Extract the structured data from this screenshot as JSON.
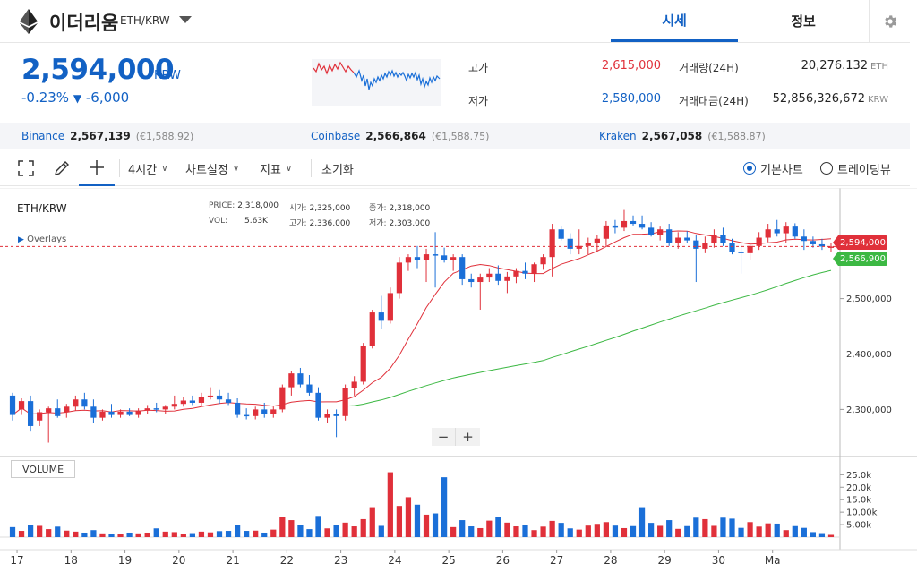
{
  "header": {
    "coin_name": "이더리움",
    "pair": "ETH/KRW",
    "tabs": [
      {
        "label": "시세",
        "active": true
      },
      {
        "label": "정보",
        "active": false
      }
    ]
  },
  "summary": {
    "price": "2,594,000",
    "unit": "KRW",
    "change_rate": "-0.23%",
    "change_arrow": "▼",
    "change_amount": "-6,000",
    "high_label": "고가",
    "high_value": "2,615,000",
    "low_label": "저가",
    "low_value": "2,580,000",
    "volume_label": "거래량(24H)",
    "volume_value": "20,276.132",
    "volume_unit": "ETH",
    "amount_label": "거래대금(24H)",
    "amount_value": "52,856,326,672",
    "amount_unit": "KRW"
  },
  "exchanges": [
    {
      "name": "Binance",
      "price": "2,567,139",
      "eur": "(€1,588.92)"
    },
    {
      "name": "Coinbase",
      "price": "2,566,864",
      "eur": "(€1,588.75)"
    },
    {
      "name": "Kraken",
      "price": "2,567,058",
      "eur": "(€1,588.87)"
    }
  ],
  "toolbar": {
    "interval": "4시간",
    "chart_settings": "차트설정",
    "indicators": "지표",
    "reset": "초기화",
    "view_basic": "기본차트",
    "view_tradingview": "트레이딩뷰"
  },
  "chart": {
    "pair": "ETH/KRW",
    "overlays": "Overlays",
    "ohlc": {
      "price_label": "PRICE:",
      "price": "2,318,000",
      "vol_label": "VOL:",
      "vol": "5.63K",
      "open_label": "시가:",
      "open": "2,325,000",
      "high_label": "고가:",
      "high": "2,336,000",
      "close_label": "종가:",
      "close": "2,318,000",
      "low_label": "저가:",
      "low": "2,303,000"
    },
    "volume_label": "VOLUME",
    "zoom_out": "−",
    "zoom_in": "+",
    "current_price_tag": "2,594,000",
    "foreign_price_tag": "2,566,900",
    "colors": {
      "up": "#e0303a",
      "down": "#1a6fd8",
      "ma_short": "#e0303a",
      "ma_long": "#3cb843",
      "price_tag_up": "#e0303a",
      "price_tag_foreign": "#3cb843"
    }
  },
  "chart_data": {
    "type": "candlestick",
    "x_ticks": [
      "17",
      "18",
      "19",
      "20",
      "21",
      "22",
      "23",
      "24",
      "25",
      "26",
      "27",
      "28",
      "29",
      "30",
      "Ma"
    ],
    "y_ticks": [
      "2,300,000",
      "2,400,000",
      "2,500,000"
    ],
    "y_tick_values": [
      2300000,
      2400000,
      2500000
    ],
    "ylim": [
      2215000,
      2690000
    ],
    "volume_ticks": [
      "25.0k",
      "20.0k",
      "15.0k",
      "10.00k",
      "5.00k"
    ],
    "volume_tick_values": [
      25000,
      20000,
      15000,
      10000,
      5000
    ],
    "volume_lim": [
      0,
      28000
    ],
    "candles": [
      [
        2325000,
        2330000,
        2280000,
        2290000,
        4000
      ],
      [
        2300000,
        2320000,
        2290000,
        2315000,
        2500
      ],
      [
        2315000,
        2325000,
        2260000,
        2270000,
        4800
      ],
      [
        2280000,
        2300000,
        2270000,
        2295000,
        4500
      ],
      [
        2295000,
        2305000,
        2240000,
        2302000,
        3200
      ],
      [
        2302000,
        2318000,
        2285000,
        2288000,
        4200
      ],
      [
        2295000,
        2310000,
        2285000,
        2305000,
        2600
      ],
      [
        2305000,
        2325000,
        2298000,
        2318000,
        2200
      ],
      [
        2318000,
        2330000,
        2300000,
        2305000,
        1800
      ],
      [
        2305000,
        2318000,
        2275000,
        2285000,
        2800
      ],
      [
        2285000,
        2300000,
        2280000,
        2296000,
        1500
      ],
      [
        2296000,
        2310000,
        2285000,
        2290000,
        1200
      ],
      [
        2290000,
        2300000,
        2285000,
        2296000,
        1400
      ],
      [
        2296000,
        2302000,
        2288000,
        2290000,
        1800
      ],
      [
        2290000,
        2302000,
        2285000,
        2298000,
        1500
      ],
      [
        2298000,
        2308000,
        2292000,
        2302000,
        1800
      ],
      [
        2302000,
        2312000,
        2295000,
        2300000,
        3500
      ],
      [
        2300000,
        2308000,
        2292000,
        2305000,
        2200
      ],
      [
        2305000,
        2325000,
        2300000,
        2310000,
        2000
      ],
      [
        2310000,
        2322000,
        2305000,
        2316000,
        1400
      ],
      [
        2316000,
        2325000,
        2308000,
        2312000,
        1600
      ],
      [
        2312000,
        2330000,
        2305000,
        2322000,
        2200
      ],
      [
        2322000,
        2340000,
        2318000,
        2325000,
        1900
      ],
      [
        2325000,
        2335000,
        2310000,
        2318000,
        2400
      ],
      [
        2318000,
        2330000,
        2308000,
        2312000,
        2500
      ],
      [
        2312000,
        2320000,
        2285000,
        2290000,
        4800
      ],
      [
        2290000,
        2302000,
        2282000,
        2288000,
        2500
      ],
      [
        2288000,
        2305000,
        2282000,
        2300000,
        2600
      ],
      [
        2300000,
        2312000,
        2285000,
        2292000,
        1800
      ],
      [
        2292000,
        2305000,
        2285000,
        2300000,
        3000
      ],
      [
        2300000,
        2345000,
        2295000,
        2340000,
        8000
      ],
      [
        2340000,
        2370000,
        2325000,
        2365000,
        6800
      ],
      [
        2365000,
        2375000,
        2340000,
        2345000,
        5000
      ],
      [
        2345000,
        2362000,
        2325000,
        2330000,
        3200
      ],
      [
        2330000,
        2340000,
        2280000,
        2285000,
        8500
      ],
      [
        2285000,
        2300000,
        2275000,
        2292000,
        3500
      ],
      [
        2292000,
        2300000,
        2250000,
        2288000,
        5000
      ],
      [
        2288000,
        2345000,
        2280000,
        2338000,
        5800
      ],
      [
        2338000,
        2360000,
        2325000,
        2350000,
        4300
      ],
      [
        2350000,
        2420000,
        2345000,
        2415000,
        7200
      ],
      [
        2415000,
        2480000,
        2410000,
        2475000,
        12000
      ],
      [
        2475000,
        2505000,
        2445000,
        2460000,
        4500
      ],
      [
        2460000,
        2520000,
        2455000,
        2510000,
        26000
      ],
      [
        2510000,
        2575000,
        2500000,
        2565000,
        12500
      ],
      [
        2565000,
        2580000,
        2550000,
        2575000,
        16000
      ],
      [
        2575000,
        2595000,
        2555000,
        2570000,
        13000
      ],
      [
        2570000,
        2590000,
        2530000,
        2580000,
        9000
      ],
      [
        2580000,
        2620000,
        2520000,
        2578000,
        9500
      ],
      [
        2578000,
        2592000,
        2565000,
        2570000,
        24000
      ],
      [
        2570000,
        2580000,
        2550000,
        2575000,
        4000
      ],
      [
        2575000,
        2580000,
        2525000,
        2535000,
        6800
      ],
      [
        2535000,
        2545000,
        2520000,
        2530000,
        4300
      ],
      [
        2530000,
        2545000,
        2480000,
        2538000,
        3600
      ],
      [
        2538000,
        2555000,
        2530000,
        2545000,
        6600
      ],
      [
        2545000,
        2560000,
        2525000,
        2532000,
        8000
      ],
      [
        2532000,
        2548000,
        2510000,
        2540000,
        5800
      ],
      [
        2540000,
        2555000,
        2528000,
        2550000,
        4300
      ],
      [
        2550000,
        2565000,
        2535000,
        2545000,
        4900
      ],
      [
        2545000,
        2565000,
        2530000,
        2562000,
        2800
      ],
      [
        2562000,
        2580000,
        2552000,
        2575000,
        4200
      ],
      [
        2575000,
        2635000,
        2540000,
        2625000,
        6500
      ],
      [
        2625000,
        2630000,
        2605000,
        2608000,
        5700
      ],
      [
        2608000,
        2618000,
        2580000,
        2590000,
        3500
      ],
      [
        2590000,
        2625000,
        2580000,
        2595000,
        3000
      ],
      [
        2595000,
        2610000,
        2580000,
        2600000,
        4600
      ],
      [
        2600000,
        2615000,
        2585000,
        2608000,
        5300
      ],
      [
        2608000,
        2640000,
        2595000,
        2632000,
        6000
      ],
      [
        2632000,
        2642000,
        2618000,
        2628000,
        4600
      ],
      [
        2628000,
        2660000,
        2622000,
        2640000,
        3600
      ],
      [
        2640000,
        2650000,
        2632000,
        2635000,
        4400
      ],
      [
        2635000,
        2650000,
        2625000,
        2628000,
        12000
      ],
      [
        2628000,
        2638000,
        2612000,
        2615000,
        5700
      ],
      [
        2615000,
        2630000,
        2605000,
        2625000,
        4500
      ],
      [
        2625000,
        2635000,
        2595000,
        2600000,
        6800
      ],
      [
        2600000,
        2620000,
        2590000,
        2610000,
        3300
      ],
      [
        2610000,
        2622000,
        2600000,
        2605000,
        4400
      ],
      [
        2605000,
        2615000,
        2530000,
        2590000,
        7800
      ],
      [
        2590000,
        2612000,
        2582000,
        2600000,
        7200
      ],
      [
        2600000,
        2625000,
        2592000,
        2615000,
        4500
      ],
      [
        2615000,
        2628000,
        2595000,
        2600000,
        7800
      ],
      [
        2600000,
        2608000,
        2580000,
        2585000,
        7400
      ],
      [
        2585000,
        2600000,
        2545000,
        2582000,
        3700
      ],
      [
        2582000,
        2600000,
        2570000,
        2595000,
        6000
      ],
      [
        2595000,
        2620000,
        2588000,
        2610000,
        4200
      ],
      [
        2610000,
        2635000,
        2602000,
        2625000,
        5500
      ],
      [
        2625000,
        2642000,
        2612000,
        2618000,
        5400
      ],
      [
        2618000,
        2638000,
        2600000,
        2630000,
        2800
      ],
      [
        2630000,
        2636000,
        2608000,
        2612000,
        4400
      ],
      [
        2612000,
        2625000,
        2588000,
        2604000,
        3700
      ],
      [
        2604000,
        2612000,
        2592000,
        2598000,
        2000
      ],
      [
        2598000,
        2608000,
        2588000,
        2594000,
        1600
      ],
      [
        2594000,
        2600000,
        2585000,
        2594000,
        900
      ]
    ]
  }
}
